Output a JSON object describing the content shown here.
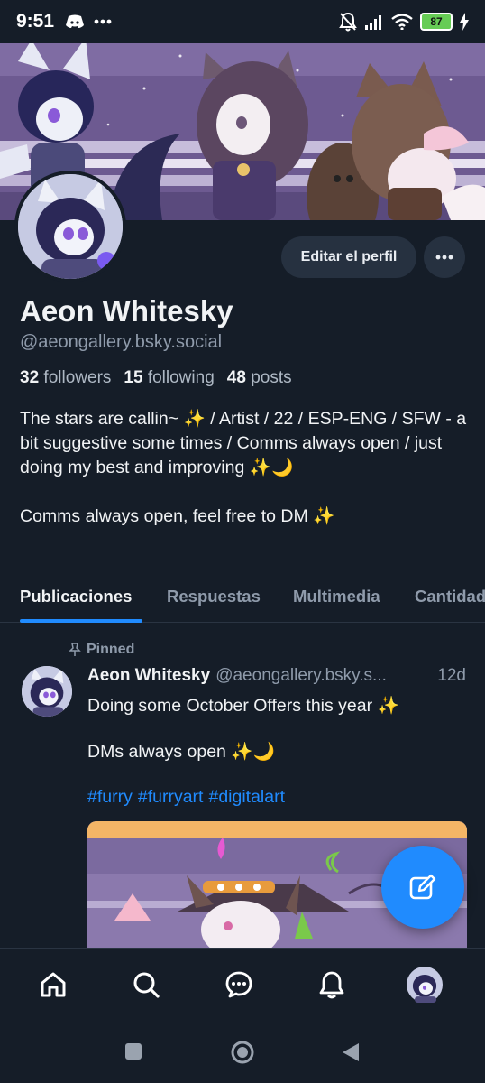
{
  "status_bar": {
    "time": "9:51",
    "battery": "87",
    "icons": [
      "discord-icon",
      "more-dots-icon",
      "mute-icon",
      "signal-icon",
      "wifi-icon",
      "battery-icon",
      "charging-icon"
    ]
  },
  "profile": {
    "display_name": "Aeon Whitesky",
    "handle": "@aeongallery.bsky.social",
    "edit_button": "Editar el perfil",
    "stats": {
      "followers_count": "32",
      "followers_label": "followers",
      "following_count": "15",
      "following_label": "following",
      "posts_count": "48",
      "posts_label": "posts"
    },
    "bio": "The stars are callin~ ✨ / Artist / 22 / ESP-ENG / SFW - a bit suggestive some times / Comms always open / just doing my best and improving ✨🌙\n\nComms always open, feel free to DM ✨"
  },
  "tabs": [
    {
      "label": "Publicaciones",
      "active": true
    },
    {
      "label": "Respuestas",
      "active": false
    },
    {
      "label": "Multimedia",
      "active": false
    },
    {
      "label": "Cantidad",
      "active": false
    }
  ],
  "post": {
    "pinned_label": "Pinned",
    "author_name": "Aeon Whitesky",
    "author_handle": "@aeongallery.bsky.s...",
    "time": "12d",
    "text_line1": "Doing some October Offers this year ✨",
    "text_line2": "DMs always open ✨🌙",
    "tags": [
      "#furry",
      "#furryart",
      "#digitalart"
    ]
  },
  "bottom_nav": [
    "home-icon",
    "search-icon",
    "chat-icon",
    "bell-icon",
    "profile-avatar"
  ],
  "colors": {
    "background": "#151d28",
    "accent": "#208bfe",
    "muted_text": "#8f9bab",
    "button_bg": "#263140"
  }
}
